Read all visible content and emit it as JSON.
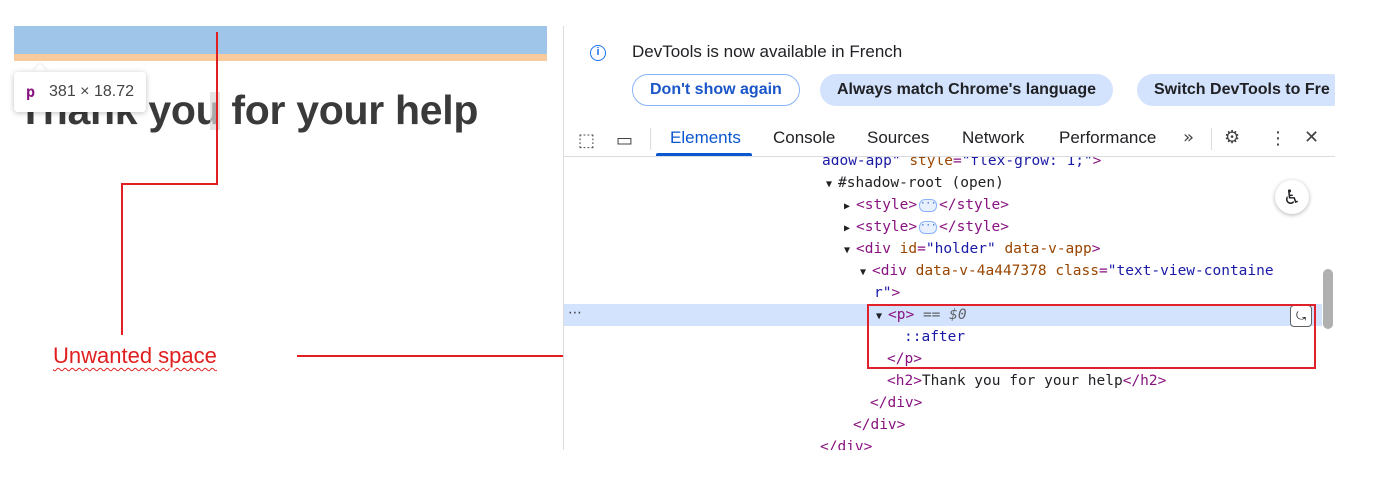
{
  "page": {
    "heading": "Thank you for your help",
    "tooltip": {
      "tag": "p",
      "dims": "381 × 18.72"
    }
  },
  "annotation": {
    "label": "Unwanted space"
  },
  "devtools": {
    "info": {
      "message": "DevTools is now available in French",
      "buttons": [
        "Don't show again",
        "Always match Chrome's language",
        "Switch DevTools to Fre"
      ]
    },
    "tabs": [
      "Elements",
      "Console",
      "Sources",
      "Network",
      "Performance"
    ],
    "active_tab": "Elements",
    "tree": {
      "l0": {
        "attr_tail": "adow-app\"",
        "style_attr": "style",
        "style_val": "\"flex-grow: 1;\"",
        "close": ">"
      },
      "l1": {
        "text": "#shadow-root (open)"
      },
      "l2": {
        "open": "<style>",
        "close": "</style>"
      },
      "l3": {
        "open": "<style>",
        "close": "</style>"
      },
      "l4": {
        "tag_open": "<div",
        "attr1": "id",
        "val1": "\"holder\"",
        "attr2": "data-v-app",
        "tag_close": ">"
      },
      "l5": {
        "tag_open": "<div",
        "attr1": "data-v-4a447378",
        "attr2": "class",
        "val2": "\"text-view-containe"
      },
      "l6": {
        "val_tail": "r\"",
        "tag_close": ">"
      },
      "l7": {
        "tag": "<p>",
        "eq": "== $0"
      },
      "l8": {
        "pseudo": "::after"
      },
      "l9": {
        "tag": "</p>"
      },
      "l10": {
        "open": "<h2>",
        "text": "Thank you for your help",
        "close": "</h2>"
      },
      "l11": {
        "tag": "</div>"
      },
      "l12": {
        "tag": "</div>"
      },
      "l13": {
        "tag": "</div>"
      }
    }
  },
  "colors": {
    "accent": "#0b57d0",
    "annotation_red": "#e02020",
    "tag": "#881280",
    "attr_name": "#994500",
    "attr_value": "#1a1aa6"
  }
}
